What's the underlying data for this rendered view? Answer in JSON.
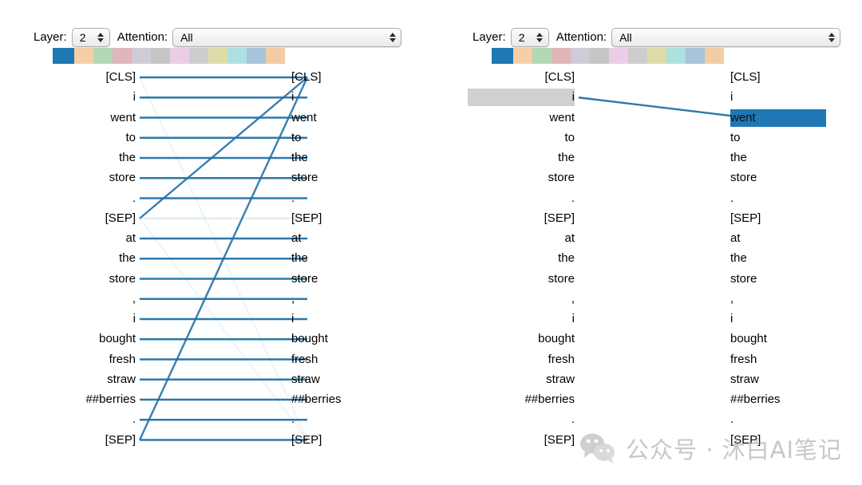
{
  "panels": [
    {
      "id": "left",
      "controls": {
        "layer_label": "Layer:",
        "layer_value": "2",
        "attention_label": "Attention:",
        "attention_value": "All"
      },
      "swatches": [
        "#1f77b4",
        "#f5cfa8",
        "#b3d8b4",
        "#e1b6bb",
        "#d0cbd8",
        "#c6c6c6",
        "#eccde6",
        "#cdcdcd",
        "#dcdda8",
        "#aee0e0",
        "#a7c4da",
        "#f2cda4"
      ],
      "source_tokens": [
        "[CLS]",
        "i",
        "went",
        "to",
        "the",
        "store",
        ".",
        "[SEP]",
        "at",
        "the",
        "store",
        ",",
        "i",
        "bought",
        "fresh",
        "straw",
        "##berries",
        ".",
        "[SEP]"
      ],
      "target_tokens": [
        "[CLS]",
        "i",
        "went",
        "to",
        "the",
        "store",
        ".",
        "[SEP]",
        "at",
        "the",
        "store",
        ",",
        "i",
        "bought",
        "fresh",
        "straw",
        "##berries",
        ".",
        "[SEP]"
      ],
      "highlight_source_index": null,
      "highlight_target_index": null,
      "links": [
        {
          "from": 0,
          "to": 0,
          "opacity": 0.95
        },
        {
          "from": 1,
          "to": 1,
          "opacity": 0.95
        },
        {
          "from": 2,
          "to": 2,
          "opacity": 0.95
        },
        {
          "from": 3,
          "to": 3,
          "opacity": 0.95
        },
        {
          "from": 4,
          "to": 4,
          "opacity": 0.95
        },
        {
          "from": 5,
          "to": 5,
          "opacity": 0.95
        },
        {
          "from": 6,
          "to": 6,
          "opacity": 0.95
        },
        {
          "from": 7,
          "to": 7,
          "opacity": 0.12
        },
        {
          "from": 8,
          "to": 8,
          "opacity": 0.95
        },
        {
          "from": 9,
          "to": 9,
          "opacity": 0.95
        },
        {
          "from": 10,
          "to": 10,
          "opacity": 0.95
        },
        {
          "from": 11,
          "to": 11,
          "opacity": 0.95
        },
        {
          "from": 12,
          "to": 12,
          "opacity": 0.95
        },
        {
          "from": 13,
          "to": 13,
          "opacity": 0.95
        },
        {
          "from": 14,
          "to": 14,
          "opacity": 0.95
        },
        {
          "from": 15,
          "to": 15,
          "opacity": 0.95
        },
        {
          "from": 16,
          "to": 16,
          "opacity": 0.95
        },
        {
          "from": 17,
          "to": 17,
          "opacity": 0.95
        },
        {
          "from": 18,
          "to": 18,
          "opacity": 0.95
        },
        {
          "from": 7,
          "to": 0,
          "opacity": 0.9
        },
        {
          "from": 18,
          "to": 0,
          "opacity": 0.9
        },
        {
          "from": 0,
          "to": 18,
          "opacity": 0.07
        },
        {
          "from": 7,
          "to": 18,
          "opacity": 0.07
        }
      ]
    },
    {
      "id": "right",
      "controls": {
        "layer_label": "Layer:",
        "layer_value": "2",
        "attention_label": "Attention:",
        "attention_value": "All"
      },
      "swatches": [
        "#1f77b4",
        "#f5cfa8",
        "#b3d8b4",
        "#e1b6bb",
        "#d0cbd8",
        "#c6c6c6",
        "#eccde6",
        "#cdcdcd",
        "#dcdda8",
        "#aee0e0",
        "#a7c4da",
        "#f2cda4"
      ],
      "source_tokens": [
        "[CLS]",
        "i",
        "went",
        "to",
        "the",
        "store",
        ".",
        "[SEP]",
        "at",
        "the",
        "store",
        ",",
        "i",
        "bought",
        "fresh",
        "straw",
        "##berries",
        ".",
        "[SEP]"
      ],
      "target_tokens": [
        "[CLS]",
        "i",
        "went",
        "to",
        "the",
        "store",
        ".",
        "[SEP]",
        "at",
        "the",
        "store",
        ",",
        "i",
        "bought",
        "fresh",
        "straw",
        "##berries",
        ".",
        "[SEP]"
      ],
      "highlight_source_index": 1,
      "highlight_target_index": 2,
      "links": [
        {
          "from": 1,
          "to": 2,
          "opacity": 0.95
        }
      ]
    }
  ],
  "watermark": {
    "text": "公众号 · 沐白AI笔记",
    "icon": "wechat-icon"
  },
  "colors": {
    "accent_blue": "#1f77b4",
    "highlight_grey": "#d0d0d0",
    "link_blue": "#2171a8"
  }
}
